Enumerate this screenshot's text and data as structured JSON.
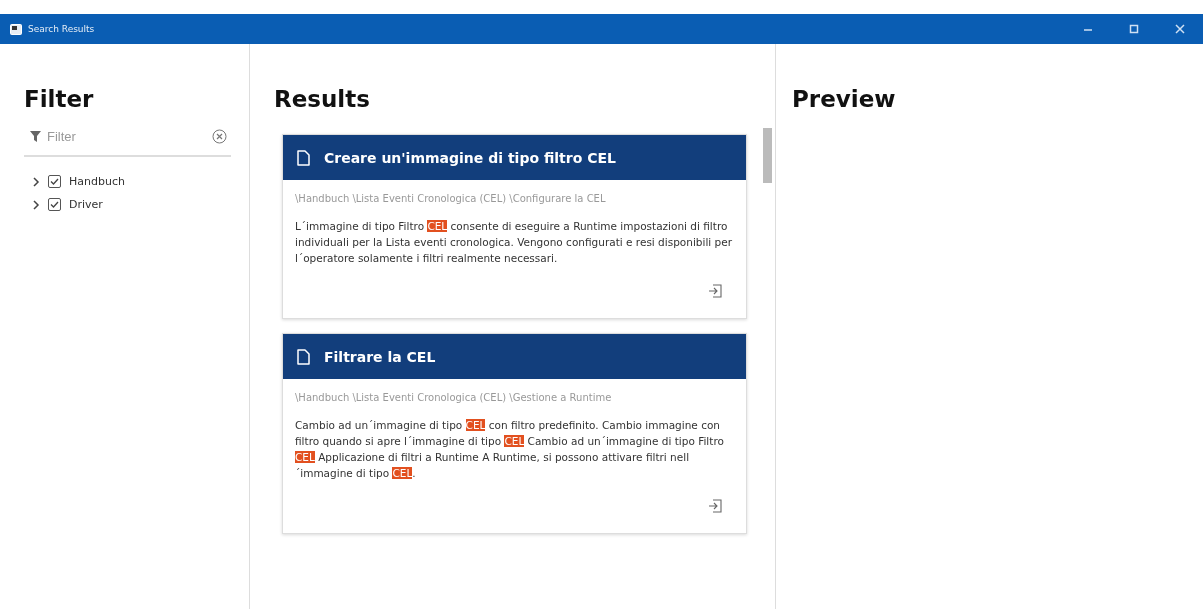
{
  "window": {
    "title": "Search Results"
  },
  "filter": {
    "heading": "Filter",
    "search": {
      "placeholder": "Filter"
    },
    "tree": [
      {
        "label": "Handbuch",
        "checked": true,
        "expanded": false
      },
      {
        "label": "Driver",
        "checked": true,
        "expanded": false
      }
    ]
  },
  "results": {
    "heading": "Results",
    "items": [
      {
        "title": "Creare un'immagine di tipo filtro CEL",
        "path": "\\Handbuch \\Lista Eventi Cronologica (CEL) \\Configurare la CEL",
        "body": [
          {
            "text": "L´immagine di tipo Filtro ",
            "highlight": false
          },
          {
            "text": "CEL",
            "highlight": true
          },
          {
            "text": " consente di eseguire a Runtime impostazioni di filtro individuali per la Lista eventi cronologica. Vengono configurati e resi disponibili per l´operatore solamente i filtri realmente necessari.",
            "highlight": false
          }
        ]
      },
      {
        "title": "Filtrare la CEL",
        "path": "\\Handbuch \\Lista Eventi Cronologica (CEL) \\Gestione a Runtime",
        "body": [
          {
            "text": "Cambio ad un´immagine di tipo ",
            "highlight": false
          },
          {
            "text": "CEL",
            "highlight": true
          },
          {
            "text": " con filtro predefinito. Cambio immagine con filtro quando si apre l´immagine di tipo ",
            "highlight": false
          },
          {
            "text": "CEL",
            "highlight": true
          },
          {
            "text": " Cambio ad un´immagine di tipo Filtro ",
            "highlight": false
          },
          {
            "text": "CEL",
            "highlight": true
          },
          {
            "text": " Applicazione di filtri a Runtime A Runtime, si possono attivare filtri nell´immagine di tipo ",
            "highlight": false
          },
          {
            "text": "CEL",
            "highlight": true
          },
          {
            "text": ".",
            "highlight": false
          }
        ]
      }
    ]
  },
  "preview": {
    "heading": "Preview"
  }
}
